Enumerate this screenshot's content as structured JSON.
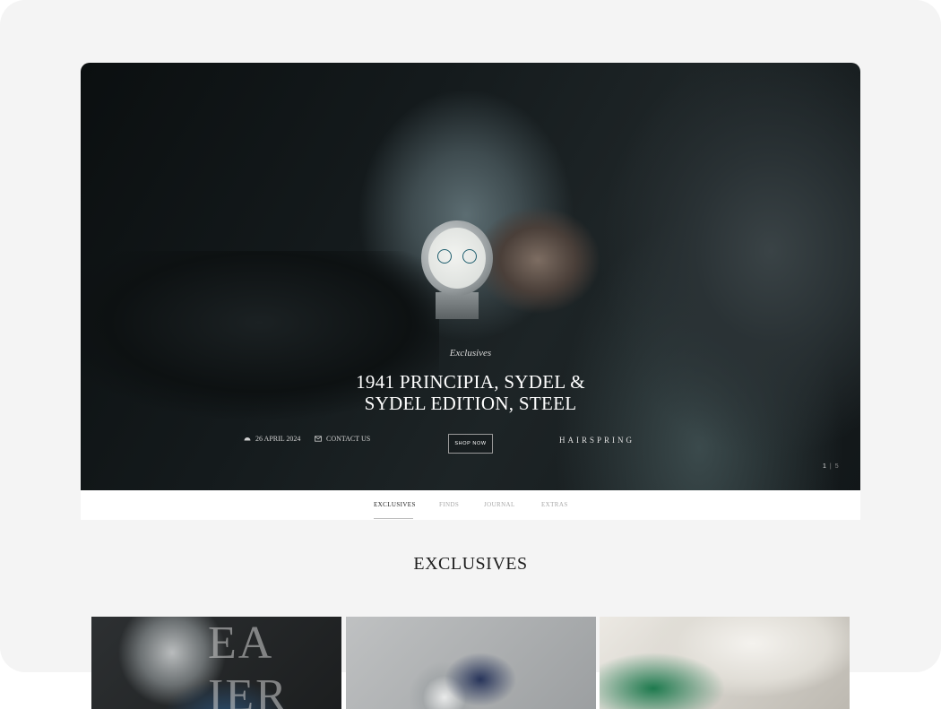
{
  "hero": {
    "kicker": "Exclusives",
    "title_line1": "1941 PRINCIPIA, SYDEL &",
    "title_line2": "SYDEL EDITION, STEEL",
    "date": "26 APRIL 2024",
    "contact": "CONTACT US",
    "shop_button": "SHOP NOW",
    "brand": "HAIRSPRING",
    "pager": {
      "current": "1",
      "separator": "|",
      "total": "5"
    }
  },
  "tabs": [
    {
      "label": "EXCLUSIVES",
      "active": true
    },
    {
      "label": "FINDS",
      "active": false
    },
    {
      "label": "JOURNAL",
      "active": false
    },
    {
      "label": "EXTRAS",
      "active": false
    }
  ],
  "section": {
    "title": "EXCLUSIVES"
  },
  "thumbnails": [
    {
      "lettering": "EA  IER"
    },
    {
      "lettering": ""
    },
    {
      "lettering": ""
    }
  ],
  "icons": {
    "date": "calendar-icon",
    "contact": "mail-icon"
  },
  "colors": {
    "hero_text": "#ffffff",
    "page_bg": "#f4f4f4",
    "active_tab": "#222222"
  }
}
